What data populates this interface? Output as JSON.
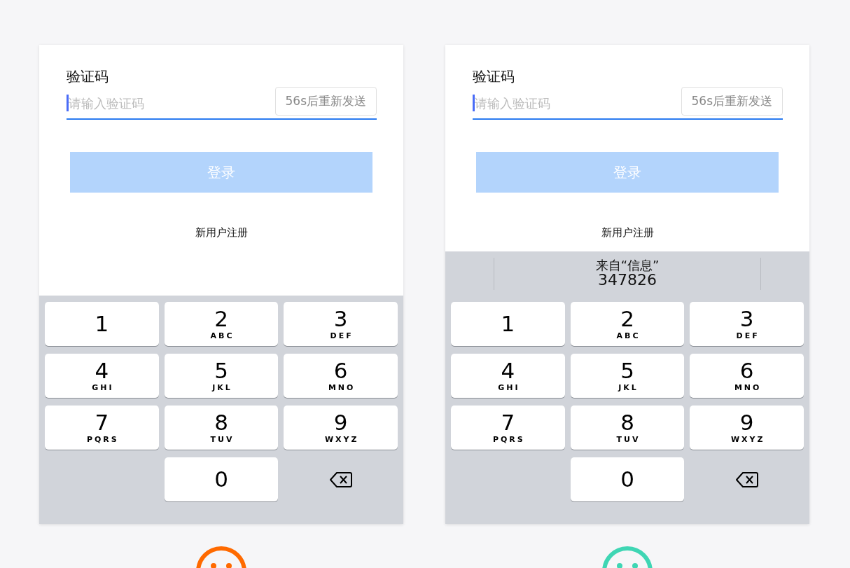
{
  "panels": [
    {
      "title": "验证码",
      "field": {
        "placeholder": "请输入验证码",
        "focused": true
      },
      "resend_button": "56s后重新发送",
      "login_button": "登录",
      "register_link": "新用户注册",
      "keys": [
        {
          "kind": "digit",
          "digit": "1"
        },
        {
          "kind": "digit",
          "digit": "2",
          "letters": "ABC"
        },
        {
          "kind": "digit",
          "digit": "3",
          "letters": "DEF"
        },
        {
          "kind": "digit",
          "digit": "4",
          "letters": "GHI"
        },
        {
          "kind": "digit",
          "digit": "5",
          "letters": "JKL"
        },
        {
          "kind": "digit",
          "digit": "6",
          "letters": "MNO"
        },
        {
          "kind": "digit",
          "digit": "7",
          "letters": "PQRS"
        },
        {
          "kind": "digit",
          "digit": "8",
          "letters": "TUV"
        },
        {
          "kind": "digit",
          "digit": "9",
          "letters": "WXYZ"
        },
        {
          "kind": "blank"
        },
        {
          "kind": "digit",
          "digit": "0"
        },
        {
          "kind": "delete"
        }
      ],
      "face": {
        "color": "#ff6a00"
      }
    },
    {
      "title": "验证码",
      "field": {
        "placeholder": "请输入验证码",
        "focused": true
      },
      "resend_button": "56s后重新发送",
      "login_button": "登录",
      "register_link": "新用户注册",
      "suggestion": {
        "source": "来自“信息”",
        "code": "347826"
      },
      "keys": [
        {
          "kind": "digit",
          "digit": "1"
        },
        {
          "kind": "digit",
          "digit": "2",
          "letters": "ABC"
        },
        {
          "kind": "digit",
          "digit": "3",
          "letters": "DEF"
        },
        {
          "kind": "digit",
          "digit": "4",
          "letters": "GHI"
        },
        {
          "kind": "digit",
          "digit": "5",
          "letters": "JKL"
        },
        {
          "kind": "digit",
          "digit": "6",
          "letters": "MNO"
        },
        {
          "kind": "digit",
          "digit": "7",
          "letters": "PQRS"
        },
        {
          "kind": "digit",
          "digit": "8",
          "letters": "TUV"
        },
        {
          "kind": "digit",
          "digit": "9",
          "letters": "WXYZ"
        },
        {
          "kind": "blank"
        },
        {
          "kind": "digit",
          "digit": "0"
        },
        {
          "kind": "delete"
        }
      ],
      "face": {
        "color": "#3fd6b4"
      }
    }
  ]
}
